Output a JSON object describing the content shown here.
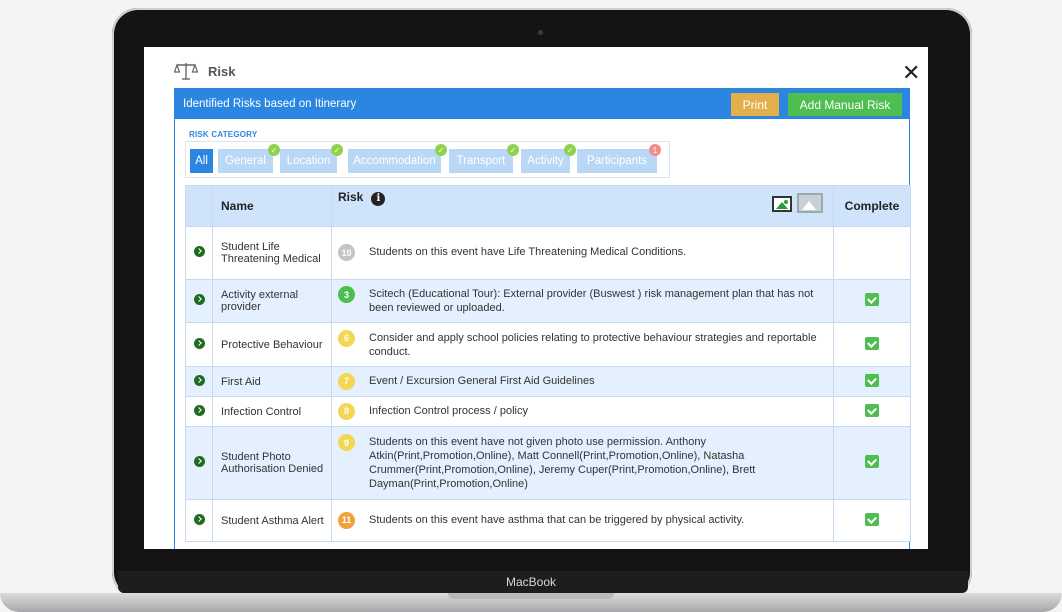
{
  "device": {
    "label": "MacBook"
  },
  "modal": {
    "title": "Risk",
    "close_glyph": "✕",
    "icon": "scale-icon"
  },
  "panel": {
    "title": "Identified Risks based on Itinerary",
    "print_label": "Print",
    "add_label": "Add Manual Risk",
    "print_color": "#e3ae4c",
    "add_color": "#4dbe4f",
    "header_color": "#2a86e0"
  },
  "categories": {
    "label": "RISK CATEGORY",
    "items": [
      {
        "label": "All",
        "active": true
      },
      {
        "label": "General",
        "status": "✓"
      },
      {
        "label": "Location",
        "status": "✓"
      },
      {
        "label": "Accommodation",
        "status": "✓"
      },
      {
        "label": "Transport",
        "status": "✓"
      },
      {
        "label": "Activity",
        "status": "✓"
      },
      {
        "label": "Participants",
        "status": "1"
      }
    ]
  },
  "table": {
    "headers": {
      "name": "Name",
      "risk": "Risk",
      "complete": "Complete"
    },
    "info_glyph": "i",
    "rows": [
      {
        "name": "Student Life Threatening Medical",
        "num": "10",
        "badge_color": "#c4c4c4",
        "text": "Students on this event have Life Threatening Medical Conditions.",
        "complete": false
      },
      {
        "name": "Activity external provider",
        "num": "3",
        "badge_color": "#4dbe4f",
        "text": "Scitech (Educational Tour): External provider (Buswest ) risk management plan that has not been reviewed or uploaded.",
        "complete": true
      },
      {
        "name": "Protective Behaviour",
        "num": "6",
        "badge_color": "#f2d654",
        "text": "Consider and apply school policies relating to protective behaviour strategies and reportable conduct.",
        "complete": true
      },
      {
        "name": "First Aid",
        "num": "7",
        "badge_color": "#f2d654",
        "text": "Event / Excursion General First Aid Guidelines",
        "complete": true
      },
      {
        "name": "Infection Control",
        "num": "8",
        "badge_color": "#f2d654",
        "text": "Infection Control process / policy",
        "complete": true
      },
      {
        "name": "Student Photo Authorisation Denied",
        "num": "9",
        "badge_color": "#f2d654",
        "text": "Students on this event have not given photo use permission. Anthony Atkin(Print,Promotion,Online), Matt Connell(Print,Promotion,Online), Natasha Crummer(Print,Promotion,Online), Jeremy Cuper(Print,Promotion,Online), Brett Dayman(Print,Promotion,Online)",
        "complete": true
      },
      {
        "name": "Student Asthma Alert",
        "num": "11",
        "badge_color": "#f0a23c",
        "text": "Students on this event have asthma that can be triggered by physical activity.",
        "complete": true
      }
    ]
  }
}
